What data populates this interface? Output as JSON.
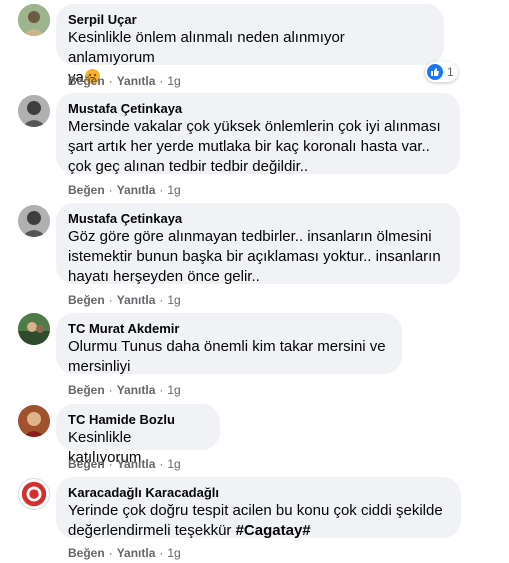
{
  "actions": {
    "like": "Beğen",
    "reply": "Yanıtla",
    "sep": "·"
  },
  "comments": [
    {
      "author": "Serpil Uçar",
      "text": "Kesinlikle önlem alınmalı neden alınmıyor anlamıyorum\nya",
      "emoji": "persevering-face",
      "time": "1g",
      "reaction_count": "1"
    },
    {
      "author": "Mustafa Çetinkaya",
      "text": "Mersinde vakalar çok yüksek önlemlerin çok iyi alınması\nşart artık her yerde mutlaka bir kaç koronalı hasta var..\nçok geç alınan tedbir tedbir değildir..",
      "time": "1g"
    },
    {
      "author": "Mustafa Çetinkaya",
      "text": "Göz göre göre alınmayan tedbirler.. insanların ölmesini\nistemektir bunun başka bir açıklaması yoktur.. insanların\nhayatı herşeyden önce gelir..",
      "time": "1g"
    },
    {
      "author": "TC Murat Akdemir",
      "text": "Olurmu Tunus daha önemli kim takar mersini ve\nmersinliyi",
      "time": "1g"
    },
    {
      "author": "TC Hamide Bozlu",
      "text": "Kesinlikle katılıyorum",
      "time": "1g"
    },
    {
      "author": "Karacadağlı Karacadağlı",
      "text": "Yerinde çok doğru tespit acilen bu konu çok ciddi şekilde\ndeğerlendirmeli teşekkür",
      "hashtag": "#Cagatay#",
      "time": "1g"
    }
  ],
  "colors": {
    "bubble": "#f0f2f5",
    "like_blue": "#1877f2",
    "meta_gray": "#65676b"
  }
}
